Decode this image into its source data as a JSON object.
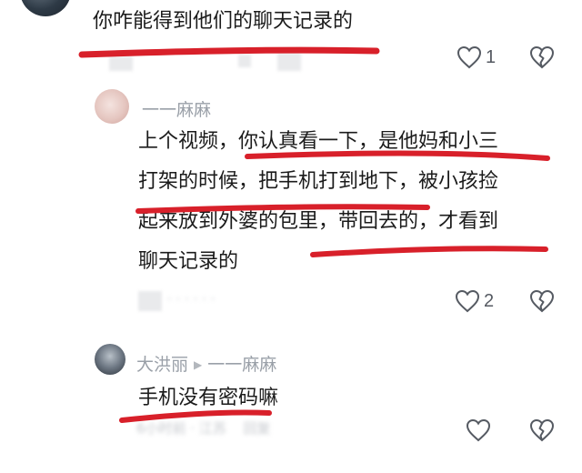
{
  "comments": [
    {
      "author": "",
      "text": "你咋能得到他们的聊天记录的",
      "like_count": "1",
      "like_icon": "heart-outline-icon",
      "dislike_icon": "broken-heart-icon"
    },
    {
      "author": "一一麻麻",
      "lines": [
        "上个视频，你认真看一下，是他妈和小三",
        "打架的时候，把手机打到地下，被小孩捡",
        "起来放到外婆的包里，带回去的，才看到",
        "聊天记录的"
      ],
      "like_count": "2",
      "like_icon": "heart-outline-icon",
      "dislike_icon": "broken-heart-icon"
    },
    {
      "author": "大洪丽",
      "reply_to": "一一麻麻",
      "text": "手机没有密码嘛",
      "meta_time": "6小时前 · 江苏",
      "meta_reply": "回复",
      "like_count": "",
      "like_icon": "heart-outline-icon",
      "dislike_icon": "broken-heart-icon"
    }
  ],
  "colors": {
    "annotation_red": "#d8202a",
    "text": "#1b1b1b",
    "muted": "#9aa0a8",
    "icon": "#555a62"
  }
}
